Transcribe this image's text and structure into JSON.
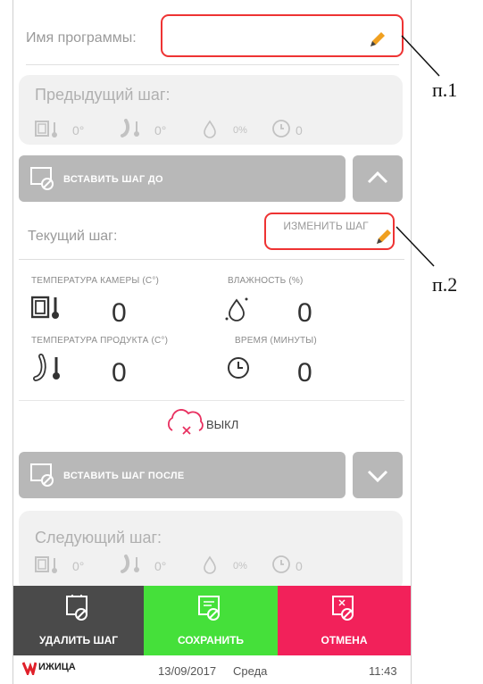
{
  "program": {
    "label": "Имя программы:",
    "value": ""
  },
  "previous_step": {
    "title": "Предыдущий шаг:",
    "temp_chamber": "0°",
    "temp_product": "0°",
    "humidity": "0%",
    "time": "0"
  },
  "insert_before": {
    "label": "ВСТАВИТЬ ШАГ ДО"
  },
  "current_step": {
    "title": "Текущий шаг:",
    "edit_label": "ИЗМЕНИТЬ ШАГ"
  },
  "parameters": {
    "chamber_temp": {
      "label": "ТЕМПЕРАТУРА КАМЕРЫ (С°)",
      "value": "0"
    },
    "humidity": {
      "label": "ВЛАЖНОСТЬ (%)",
      "value": "0"
    },
    "product_temp": {
      "label": "ТЕМПЕРАТУРА ПРОДУКТА (С°)",
      "value": "0"
    },
    "time": {
      "label": "ВРЕМЯ (МИНУТЫ)",
      "value": "0"
    }
  },
  "smoke": {
    "status": "ВЫКЛ"
  },
  "insert_after": {
    "label": "ВСТАВИТЬ ШАГ ПОСЛЕ"
  },
  "next_step": {
    "title": "Следующий шаг:",
    "temp_chamber": "0°",
    "temp_product": "0°",
    "humidity": "0%",
    "time": "0"
  },
  "actions": {
    "delete": "УДАЛИТЬ ШАГ",
    "save": "СОХРАНИТЬ",
    "cancel": "ОТМЕНА"
  },
  "footer": {
    "brand": "ИЖИЦА",
    "date": "13/09/2017",
    "weekday": "Среда",
    "time": "11:43"
  },
  "callouts": {
    "p1": "п.1",
    "p2": "п.2"
  },
  "colors": {
    "save": "#45e03a",
    "cancel": "#f2215a",
    "delete": "#4a4a4a",
    "accent_red": "#e83030",
    "pencil": "#f0a020"
  }
}
